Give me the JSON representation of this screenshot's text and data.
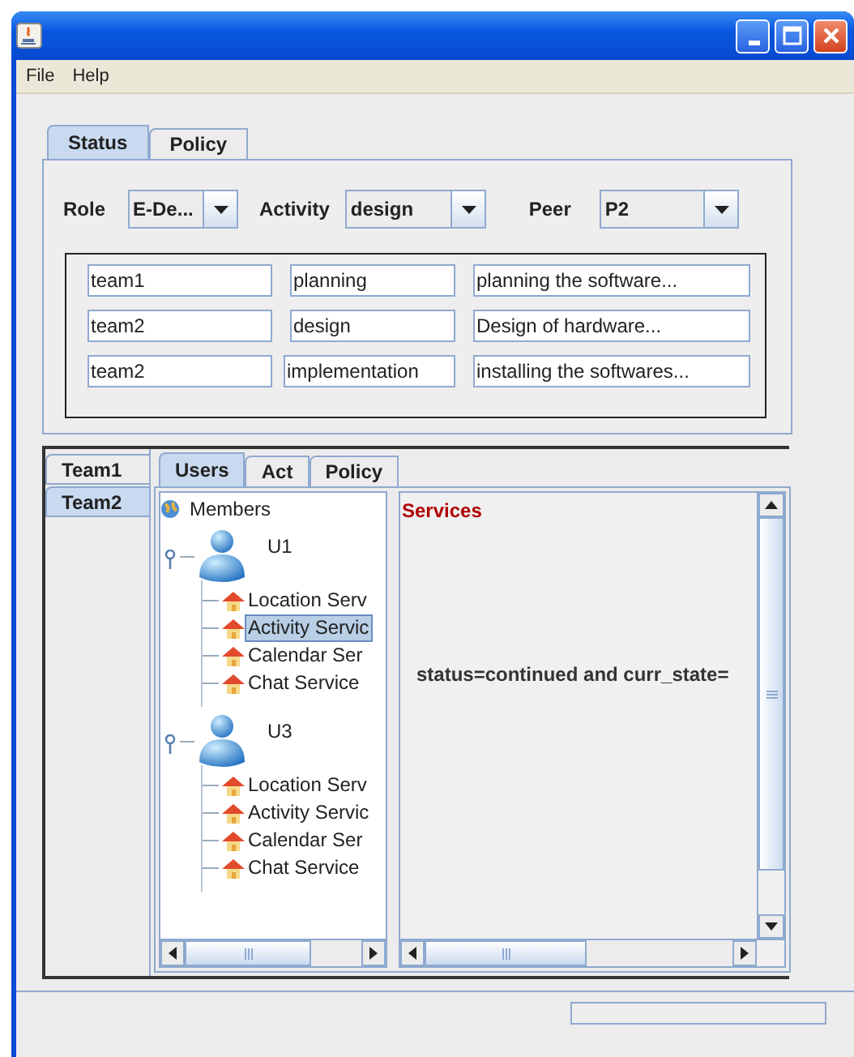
{
  "menu": [
    {
      "label": "File"
    },
    {
      "label": "Help"
    }
  ],
  "top_tabs": [
    {
      "label": "Status",
      "selected": true
    },
    {
      "label": "Policy",
      "selected": false
    }
  ],
  "filters": [
    {
      "label": "Role",
      "value": "E-De..."
    },
    {
      "label": "Activity",
      "value": "design"
    },
    {
      "label": "Peer",
      "value": "P2"
    }
  ],
  "assignments": [
    {
      "team": "team1",
      "activity": "planning",
      "description": "planning the software..."
    },
    {
      "team": "team2",
      "activity": "design",
      "description": "Design of hardware..."
    },
    {
      "team": "team2",
      "activity": "implementation",
      "description": "installing the softwares..."
    }
  ],
  "team_tabs": [
    {
      "label": "Team1",
      "selected": false
    },
    {
      "label": "Team2",
      "selected": true
    }
  ],
  "inner_tabs": [
    {
      "label": "Users",
      "selected": true
    },
    {
      "label": "Act",
      "selected": false
    },
    {
      "label": "Policy",
      "selected": false
    }
  ],
  "tree": {
    "root": "Members",
    "children": [
      {
        "label": "U1",
        "expanded": true,
        "children": [
          {
            "label": "Location Serv",
            "selected": false
          },
          {
            "label": "Activity Servic",
            "selected": true
          },
          {
            "label": "Calendar Ser",
            "selected": false
          },
          {
            "label": "Chat Service",
            "selected": false
          }
        ]
      },
      {
        "label": "U3",
        "expanded": true,
        "children": [
          {
            "label": "Location Serv",
            "selected": false
          },
          {
            "label": "Activity Servic",
            "selected": false
          },
          {
            "label": "Calendar Ser",
            "selected": false
          },
          {
            "label": "Chat Service",
            "selected": false
          }
        ]
      }
    ]
  },
  "details": {
    "heading": "Services",
    "text": "status=continued and curr_state="
  }
}
